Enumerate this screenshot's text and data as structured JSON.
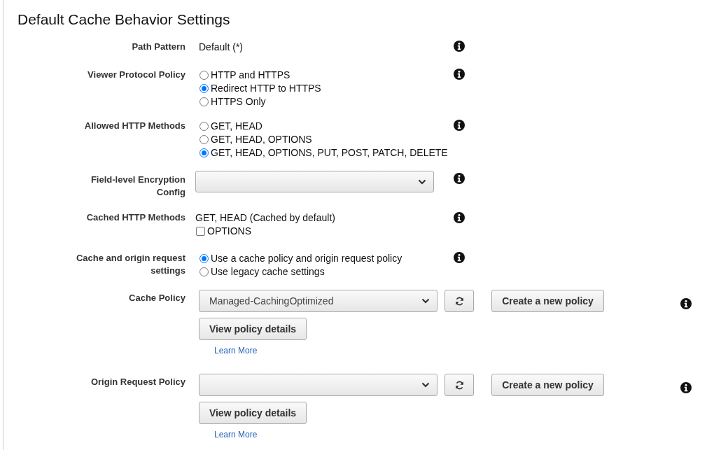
{
  "title": "Default Cache Behavior Settings",
  "rows": [
    {
      "kind": "text",
      "label": "Path Pattern",
      "value": "Default (*)"
    },
    {
      "kind": "radio",
      "label": "Viewer Protocol Policy",
      "options": [
        {
          "label": "HTTP and HTTPS",
          "selected": false
        },
        {
          "label": "Redirect HTTP to HTTPS",
          "selected": true
        },
        {
          "label": "HTTPS Only",
          "selected": false
        }
      ]
    },
    {
      "kind": "radio",
      "label": "Allowed HTTP Methods",
      "options": [
        {
          "label": "GET, HEAD",
          "selected": false
        },
        {
          "label": "GET, HEAD, OPTIONS",
          "selected": false
        },
        {
          "label": "GET, HEAD, OPTIONS, PUT, POST, PATCH, DELETE",
          "selected": true
        }
      ]
    },
    {
      "kind": "select",
      "label": "Field-level Encryption Config"
    },
    {
      "kind": "cached",
      "label": "Cached HTTP Methods",
      "value": "GET, HEAD (Cached by default)",
      "checkbox": {
        "label": "OPTIONS",
        "checked": false
      }
    },
    {
      "kind": "radio",
      "label": "Cache and origin request settings",
      "options": [
        {
          "label": "Use a cache policy and origin request policy",
          "selected": true
        },
        {
          "label": "Use legacy cache settings",
          "selected": false
        }
      ]
    },
    {
      "kind": "policy",
      "label": "Cache Policy",
      "value": "Managed-CachingOptimized",
      "create": "Create a new policy",
      "details": "View policy details",
      "link": "Learn More"
    },
    {
      "kind": "policy",
      "label": "Origin Request Policy",
      "create": "Create a new policy",
      "details": "View policy details",
      "link": "Learn More"
    }
  ]
}
